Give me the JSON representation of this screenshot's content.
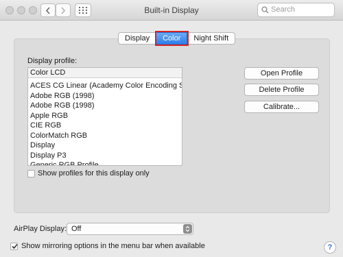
{
  "window": {
    "title": "Built-in Display"
  },
  "search": {
    "placeholder": "Search"
  },
  "tabs": [
    {
      "label": "Display",
      "selected": false
    },
    {
      "label": "Color",
      "selected": true
    },
    {
      "label": "Night Shift",
      "selected": false
    }
  ],
  "profiles": {
    "section_label": "Display profile:",
    "header": "Color LCD",
    "items": [
      "ACES CG Linear (Academy Color Encoding Sy…",
      "Adobe RGB (1998)",
      "Adobe RGB (1998)",
      "Apple RGB",
      "CIE RGB",
      "ColorMatch RGB",
      "Display",
      "Display P3",
      "Generic RGB Profile"
    ],
    "only_this_display_label": "Show profiles for this display only",
    "only_this_display_checked": false
  },
  "buttons": {
    "open_profile": "Open Profile",
    "delete_profile": "Delete Profile",
    "calibrate": "Calibrate..."
  },
  "airplay": {
    "label": "AirPlay Display:",
    "selected": "Off"
  },
  "mirroring": {
    "label": "Show mirroring options in the menu bar when available",
    "checked": true
  },
  "help": {
    "label": "?"
  },
  "colors": {
    "accent": "#2f7ee8",
    "highlight_outline": "#d72424"
  }
}
